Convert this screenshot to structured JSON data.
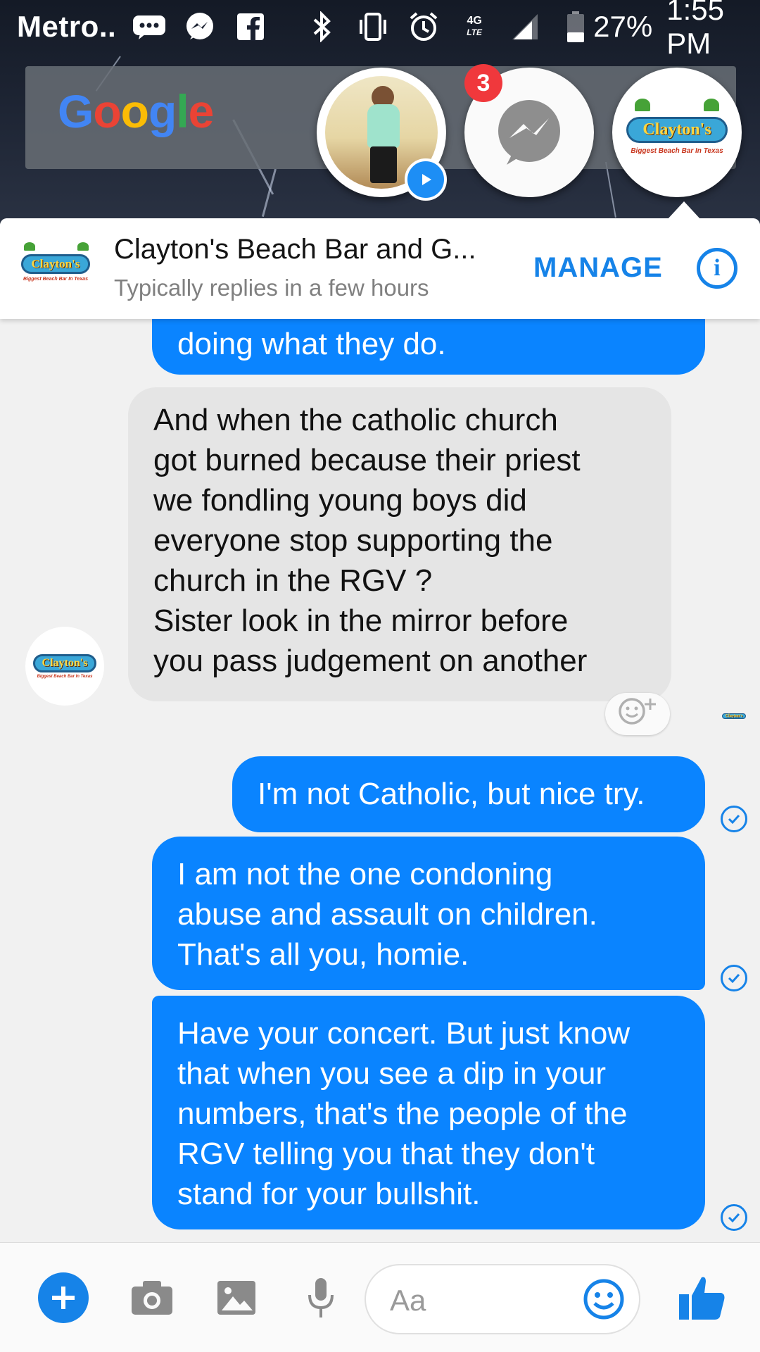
{
  "status_bar": {
    "carrier": "Metro..",
    "battery": "27%",
    "time": "1:55 PM",
    "network": "4G",
    "icons": [
      "chat-dots-icon",
      "messenger-icon",
      "facebook-icon",
      "bluetooth-icon",
      "vibrate-icon",
      "alarm-icon",
      "lte-icon",
      "signal-icon",
      "battery-icon"
    ]
  },
  "home": {
    "google_logo": "Google"
  },
  "chat_heads": {
    "unread_count": "3"
  },
  "logo": {
    "name": "Clayton's",
    "tagline": "Biggest Beach Bar In Texas"
  },
  "conversation": {
    "title": "Clayton's Beach Bar and G...",
    "subtitle": "Typically replies in a few hours",
    "manage_label": "MANAGE",
    "info_label": "i"
  },
  "messages": [
    {
      "from": "me",
      "lines": [
        "doing what they do."
      ]
    },
    {
      "from": "page",
      "lines": [
        "And when the catholic church",
        "got burned because their priest",
        "we fondling young boys did",
        "everyone stop supporting the",
        "church in the RGV ?",
        "Sister look in the mirror before",
        "you pass judgement on another"
      ]
    },
    {
      "from": "me",
      "lines": [
        "I'm not Catholic, but nice try."
      ]
    },
    {
      "from": "me",
      "lines": [
        "I am not the one condoning",
        "abuse and assault on children.",
        "That's all you, homie."
      ]
    },
    {
      "from": "me",
      "lines": [
        "Have your concert. But just know",
        "that when you see a dip in your",
        "numbers, that's the people of the",
        "RGV telling you that they don't",
        "stand for your bullshit."
      ]
    }
  ],
  "composer": {
    "placeholder": "Aa"
  },
  "colors": {
    "accent": "#1683e8",
    "outgoing_bubble": "#0a84ff",
    "incoming_bubble": "#e5e5e5",
    "badge": "#f0383c"
  }
}
